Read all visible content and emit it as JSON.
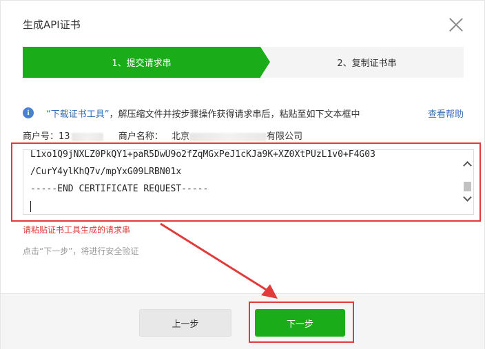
{
  "dialog": {
    "title": "生成API证书",
    "close_icon": "close-icon"
  },
  "steps": [
    {
      "label": "1、提交请求串",
      "active": true
    },
    {
      "label": "2、复制证书串",
      "active": false
    }
  ],
  "info": {
    "icon": "info-icon",
    "link_text": "“下载证书工具”",
    "text": "，解压缩文件并按步骤操作获得请求串后，粘贴至如下文本框中",
    "help_link": "查看帮助"
  },
  "merchant": {
    "id_label": "商户号：",
    "id_value": "13",
    "name_label": "商户名称：",
    "name_prefix": "北京",
    "name_suffix": "有限公司"
  },
  "textarea": {
    "lines": [
      "L1xo1Q9jNXLZ0PkQY1+paR5DwU9o2fZqMGxPeJ1cKJa9K+XZ0XtPUzL1v0+F4G03",
      "/CurY4ylKhQ7v/mpYxG09LRBN01x",
      "-----END CERTIFICATE REQUEST-----"
    ]
  },
  "messages": {
    "error": "请粘贴证书工具生成的请求串",
    "hint": "点击“下一步”，将进行安全验证"
  },
  "buttons": {
    "prev": "上一步",
    "next": "下一步"
  },
  "colors": {
    "accent": "#1aad19",
    "annotation": "#e23a3a",
    "link": "#3b6fb6"
  }
}
